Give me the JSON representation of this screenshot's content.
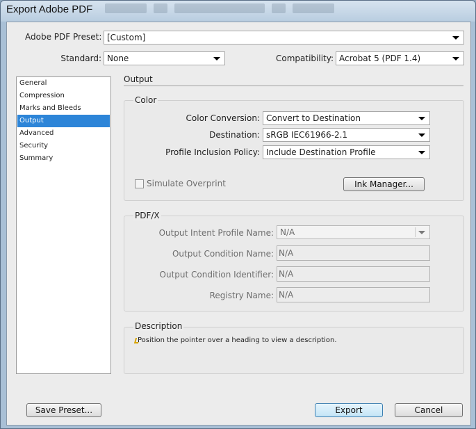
{
  "window": {
    "title": "Export Adobe PDF"
  },
  "header": {
    "preset_label": "Adobe PDF Preset:",
    "preset_value": "[Custom]",
    "standard_label": "Standard:",
    "standard_value": "None",
    "compat_label": "Compatibility:",
    "compat_value": "Acrobat 5 (PDF 1.4)"
  },
  "sidebar": {
    "items": [
      {
        "label": "General"
      },
      {
        "label": "Compression"
      },
      {
        "label": "Marks and Bleeds"
      },
      {
        "label": "Output",
        "selected": true
      },
      {
        "label": "Advanced"
      },
      {
        "label": "Security"
      },
      {
        "label": "Summary"
      }
    ]
  },
  "panel": {
    "title": "Output",
    "color": {
      "title": "Color",
      "conversion_label": "Color Conversion:",
      "conversion_value": "Convert to Destination",
      "destination_label": "Destination:",
      "destination_value": "sRGB IEC61966-2.1",
      "policy_label": "Profile Inclusion Policy:",
      "policy_value": "Include Destination Profile",
      "simulate_label": "Simulate Overprint",
      "simulate_checked": false,
      "ink_manager_label": "Ink Manager..."
    },
    "pdfx": {
      "title": "PDF/X",
      "intent_label": "Output Intent Profile Name:",
      "intent_value": "N/A",
      "condition_name_label": "Output Condition Name:",
      "condition_name_value": "N/A",
      "condition_id_label": "Output Condition Identifier:",
      "condition_id_value": "N/A",
      "registry_label": "Registry Name:",
      "registry_value": "N/A"
    },
    "description": {
      "title": "Description",
      "text": "Position the pointer over a heading to view a description."
    }
  },
  "footer": {
    "save_preset_label": "Save Preset...",
    "export_label": "Export",
    "cancel_label": "Cancel"
  }
}
